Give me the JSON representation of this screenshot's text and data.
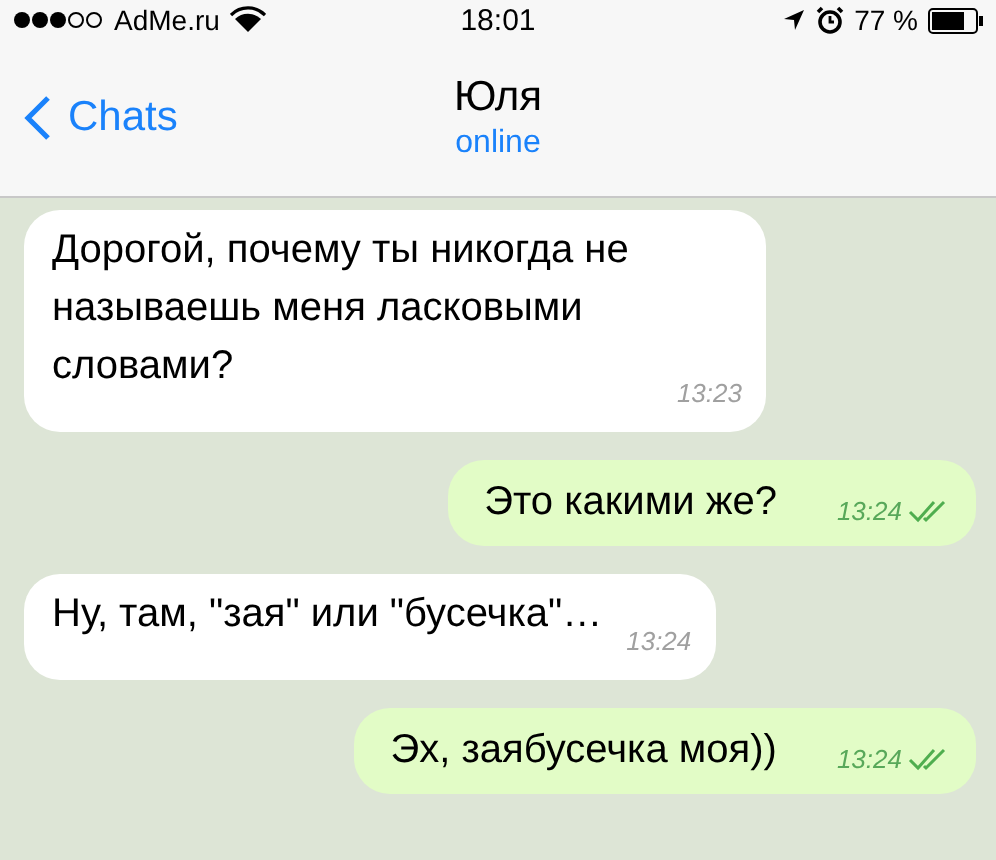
{
  "status_bar": {
    "carrier": "AdMe.ru",
    "time": "18:01",
    "battery_text": "77 %"
  },
  "header": {
    "back_label": "Chats",
    "title": "Юля",
    "subtitle": "online"
  },
  "messages": [
    {
      "kind": "incoming",
      "text": "Дорогой, почему ты никогда не называешь меня ласковыми словами?",
      "time": "13:23"
    },
    {
      "kind": "outgoing",
      "text": "Это какими же?",
      "time": "13:24",
      "read": true
    },
    {
      "kind": "incoming",
      "text": "Ну, там, \"зая\" или \"бусечка\"…",
      "time": "13:24"
    },
    {
      "kind": "outgoing",
      "text": "Эх, заябусечка моя))",
      "time": "13:24",
      "read": true
    }
  ]
}
